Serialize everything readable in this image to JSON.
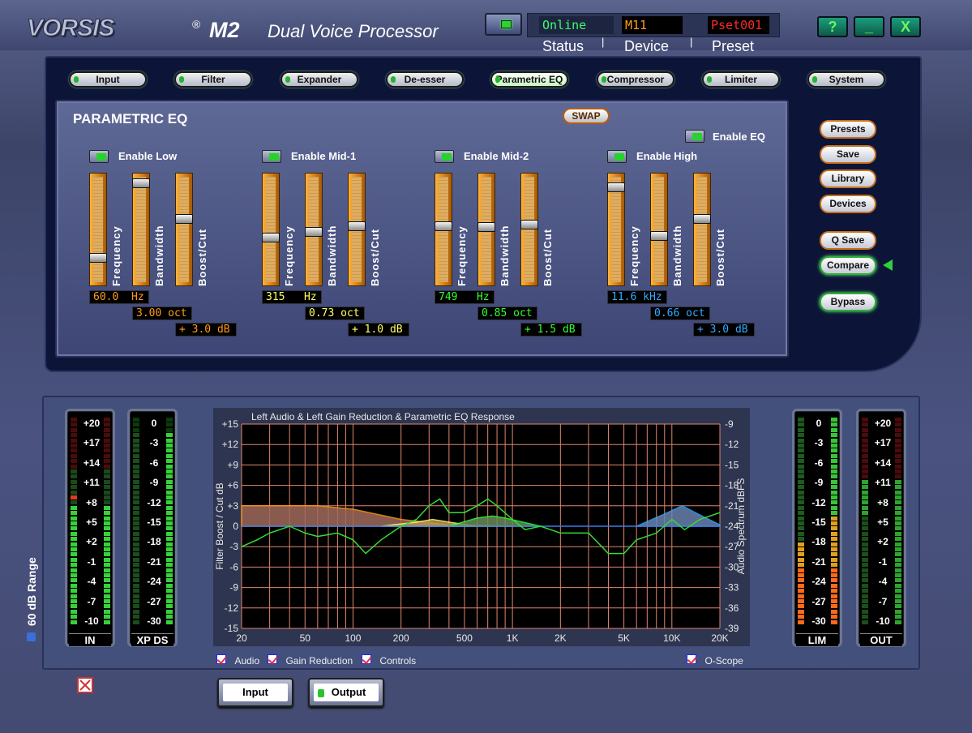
{
  "header": {
    "logo_text": "VORSIS",
    "logo_mark": "®",
    "model": "M2",
    "subtitle": "Dual Voice Processor",
    "status_value": "Online",
    "device_value": "M11",
    "preset_value": "Pset001",
    "status_label": "Status",
    "device_label": "Device",
    "preset_label": "Preset",
    "sep": "|",
    "help_label": "?",
    "minimize_label": "_",
    "close_label": "X"
  },
  "tabs": [
    {
      "label": "Input"
    },
    {
      "label": "Filter"
    },
    {
      "label": "Expander"
    },
    {
      "label": "De-esser"
    },
    {
      "label": "Parametric EQ"
    },
    {
      "label": "Compressor"
    },
    {
      "label": "Limiter"
    },
    {
      "label": "System"
    }
  ],
  "peq": {
    "title": "PARAMETRIC EQ",
    "swap_label": "SWAP",
    "enable_eq_label": "Enable EQ",
    "bands": [
      {
        "enable_label": "Enable Low",
        "freq": "60.0  Hz",
        "bw": "3.00 oct",
        "gain": "+ 3.0 dB",
        "color": "#ff9a1a",
        "freq_level": 0.22,
        "bw_level": 0.95,
        "gain_level": 0.6
      },
      {
        "enable_label": "Enable Mid-1",
        "freq": "315   Hz",
        "bw": "0.73 oct",
        "gain": "+ 1.0 dB",
        "color": "#ffff66",
        "freq_level": 0.42,
        "bw_level": 0.48,
        "gain_level": 0.53
      },
      {
        "enable_label": "Enable Mid-2",
        "freq": "749   Hz",
        "bw": "0.85 oct",
        "gain": "+ 1.5 dB",
        "color": "#33ff33",
        "freq_level": 0.53,
        "bw_level": 0.52,
        "gain_level": 0.55
      },
      {
        "enable_label": "Enable High",
        "freq": "11.6 kHz",
        "bw": "0.66 oct",
        "gain": "+ 3.0 dB",
        "color": "#33aaff",
        "freq_level": 0.91,
        "bw_level": 0.44,
        "gain_level": 0.6
      }
    ],
    "param_labels": [
      "Frequency",
      "Bandwidth",
      "Boost/Cut"
    ]
  },
  "right_buttons": {
    "presets": "Presets",
    "save": "Save",
    "library": "Library",
    "devices": "Devices",
    "qsave": "Q Save",
    "compare": "Compare",
    "bypass": "Bypass"
  },
  "meters": [
    {
      "name": "IN",
      "ticks": [
        "+20",
        "+17",
        "+14",
        "+11",
        "+8",
        "+5",
        "+2",
        "-1",
        "-4",
        "-7",
        "-10"
      ]
    },
    {
      "name": "XP DS",
      "ticks": [
        "0",
        "-3",
        "-6",
        "-9",
        "-12",
        "-15",
        "-18",
        "-21",
        "-24",
        "-27",
        "-30"
      ]
    },
    {
      "name": "LIM",
      "ticks": [
        "0",
        "-3",
        "-6",
        "-9",
        "-12",
        "-15",
        "-18",
        "-21",
        "-24",
        "-27",
        "-30"
      ]
    },
    {
      "name": "OUT",
      "ticks": [
        "+20",
        "+17",
        "+14",
        "+11",
        "+8",
        "+5",
        "+2",
        "-1",
        "-4",
        "-7",
        "-10"
      ]
    }
  ],
  "range_label": "60 dB Range",
  "chart_data": {
    "type": "line",
    "title": "Left Audio & Left Gain Reduction & Parametric EQ Response",
    "xlabel": "",
    "ylabel": "Filter Boost / Cut dB",
    "y2label": "Audio Spectrum dBFS",
    "x_ticks": [
      "20",
      "50",
      "100",
      "200",
      "500",
      "1K",
      "2K",
      "5K",
      "10K",
      "20K"
    ],
    "x_tick_values": [
      20,
      50,
      100,
      200,
      500,
      1000,
      2000,
      5000,
      10000,
      20000
    ],
    "y_ticks": [
      "+15",
      "+12",
      "+9",
      "+6",
      "+3",
      "0",
      "-3",
      "-6",
      "-9",
      "-12",
      "-15"
    ],
    "y2_ticks": [
      "-9",
      "-12",
      "-15",
      "-18",
      "-21",
      "-24",
      "-27",
      "-30",
      "-33",
      "-36",
      "-39"
    ],
    "ylim": [
      -15,
      15
    ],
    "xlim": [
      20,
      20000
    ],
    "x_scale": "log",
    "series": [
      {
        "x": [
          20,
          40,
          60,
          100,
          200,
          400,
          1000
        ],
        "y": [
          3,
          3,
          3,
          2.5,
          1,
          0.2,
          0
        ],
        "color": "#ff9a1a"
      },
      {
        "x": [
          150,
          250,
          315,
          400,
          600
        ],
        "y": [
          0,
          0.6,
          1,
          0.6,
          0
        ],
        "color": "#ffff66"
      },
      {
        "x": [
          400,
          600,
          749,
          900,
          1500
        ],
        "y": [
          0,
          1.2,
          1.5,
          1.2,
          0
        ],
        "color": "#33ff33"
      },
      {
        "x": [
          6000,
          9000,
          11600,
          14000,
          20000
        ],
        "y": [
          0,
          1.8,
          3,
          2,
          0.2
        ],
        "color": "#33aaff"
      },
      {
        "x": [
          20,
          25,
          30,
          40,
          50,
          60,
          80,
          100,
          120,
          150,
          200,
          250,
          300,
          350,
          400,
          500,
          600,
          700,
          800,
          1000,
          1200,
          1500,
          2000,
          3000,
          4000,
          5000,
          6000,
          8000,
          10000,
          12000,
          15000,
          20000
        ],
        "y": [
          -3,
          -2,
          -1,
          0,
          -1,
          -1.5,
          -1,
          -2,
          -4,
          -2,
          0,
          1,
          3,
          4,
          2,
          2,
          3,
          4,
          3,
          1,
          -0.5,
          0,
          -1,
          -1,
          -4,
          -4,
          -2,
          -1,
          1,
          -0.5,
          1,
          2
        ],
        "color": "#33dd33"
      }
    ],
    "checkboxes": [
      "Audio",
      "Gain Reduction",
      "Controls",
      "O-Scope"
    ]
  },
  "bottom_buttons": {
    "input": "Input",
    "output": "Output"
  }
}
